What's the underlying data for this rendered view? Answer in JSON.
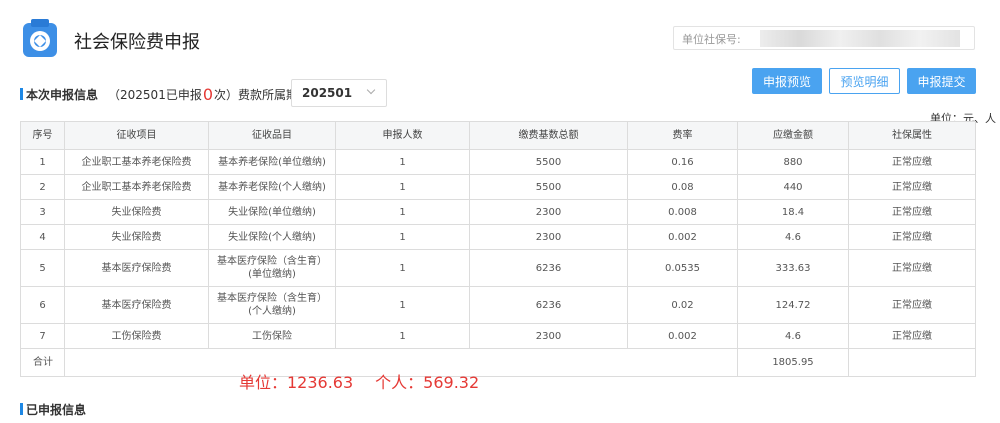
{
  "header": {
    "title": "社会保险费申报",
    "unit_label": "单位社保号:"
  },
  "info": {
    "section_title": "本次申报信息",
    "filed_prefix": "（202501已申报",
    "filed_count": "0",
    "filed_suffix": "次）费款所属期：",
    "period_value": "202501"
  },
  "toolbar": {
    "preview_label": "申报预览",
    "detail_label": "预览明细",
    "submit_label": "申报提交"
  },
  "unit_note": "单位：元、人",
  "table": {
    "headers": [
      "序号",
      "征收项目",
      "征收品目",
      "申报人数",
      "缴费基数总额",
      "费率",
      "应缴金额",
      "社保属性"
    ],
    "rows": [
      [
        "1",
        "企业职工基本养老保险费",
        "基本养老保险(单位缴纳)",
        "1",
        "5500",
        "0.16",
        "880",
        "正常应缴"
      ],
      [
        "2",
        "企业职工基本养老保险费",
        "基本养老保险(个人缴纳)",
        "1",
        "5500",
        "0.08",
        "440",
        "正常应缴"
      ],
      [
        "3",
        "失业保险费",
        "失业保险(单位缴纳)",
        "1",
        "2300",
        "0.008",
        "18.4",
        "正常应缴"
      ],
      [
        "4",
        "失业保险费",
        "失业保险(个人缴纳)",
        "1",
        "2300",
        "0.002",
        "4.6",
        "正常应缴"
      ],
      [
        "5",
        "基本医疗保险费",
        "基本医疗保险（含生育）(单位缴纳)",
        "1",
        "6236",
        "0.0535",
        "333.63",
        "正常应缴"
      ],
      [
        "6",
        "基本医疗保险费",
        "基本医疗保险（含生育）(个人缴纳)",
        "1",
        "6236",
        "0.02",
        "124.72",
        "正常应缴"
      ],
      [
        "7",
        "工伤保险费",
        "工伤保险",
        "1",
        "2300",
        "0.002",
        "4.6",
        "正常应缴"
      ]
    ],
    "total_label": "合计",
    "total_amount": "1805.95"
  },
  "overlay": {
    "unit_text": "单位：1236.63",
    "personal_text": "个人：569.32"
  },
  "section2_title": "已申报信息",
  "colors": {
    "accent": "#4aa3f0",
    "highlight": "#e53935"
  }
}
